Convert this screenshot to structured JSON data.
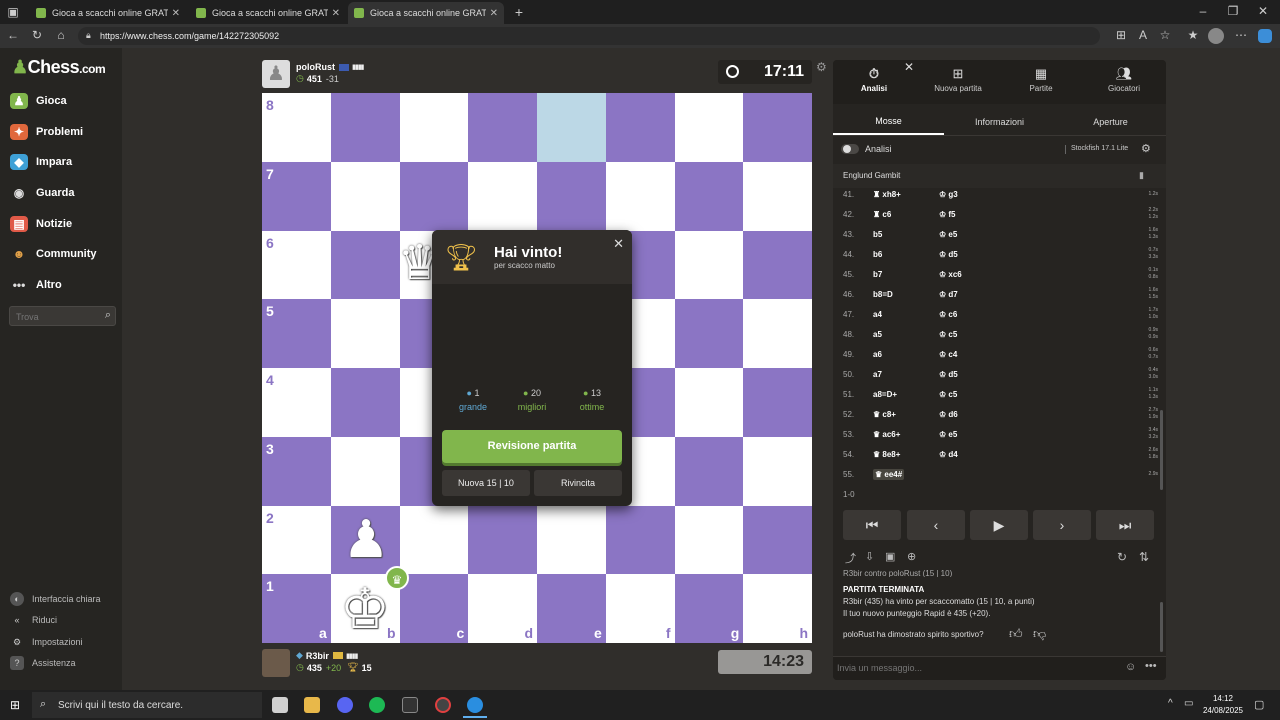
{
  "browser": {
    "tabs": [
      {
        "title": "Gioca a scacchi online GRATIS - S"
      },
      {
        "title": "Gioca a scacchi online GRATIS - S"
      },
      {
        "title": "Gioca a scacchi online GRATIS - S"
      }
    ],
    "url": "https://www.chess.com/game/142272305092"
  },
  "sidebar": {
    "logo": "Chess",
    "logo_suffix": ".com",
    "items": [
      {
        "label": "Gioca",
        "icon": "play-icon",
        "color": "#81b64c"
      },
      {
        "label": "Problemi",
        "icon": "puzzle-icon",
        "color": "#e0683c"
      },
      {
        "label": "Impara",
        "icon": "learn-icon",
        "color": "#3ea0d6"
      },
      {
        "label": "Guarda",
        "icon": "watch-icon",
        "color": "#dddddd"
      },
      {
        "label": "Notizie",
        "icon": "news-icon",
        "color": "#e05a48"
      },
      {
        "label": "Community",
        "icon": "community-icon",
        "color": "#e0a048"
      },
      {
        "label": "Altro",
        "icon": "more-icon",
        "color": "#dddddd"
      }
    ],
    "search_placeholder": "Trova",
    "bottom_items": [
      {
        "label": "Interfaccia chiara"
      },
      {
        "label": "Riduci"
      },
      {
        "label": "Impostazioni"
      },
      {
        "label": "Assistenza"
      }
    ]
  },
  "top_player": {
    "name": "poloRust",
    "rating": "451",
    "rating_change": "-31",
    "clock": "17:11"
  },
  "bottom_player": {
    "name": "R3bir",
    "rating": "435",
    "rating_change": "+20",
    "trophies": "15",
    "clock": "14:23"
  },
  "board": {
    "ranks": [
      "8",
      "7",
      "6",
      "5",
      "4",
      "3",
      "2",
      "1"
    ],
    "files": [
      "a",
      "b",
      "c",
      "d",
      "e",
      "f",
      "g",
      "h"
    ],
    "light_color": "#ffffff",
    "dark_color": "#8b75c4",
    "highlight_color": "#bcd8e6"
  },
  "modal": {
    "title": "Hai vinto!",
    "subtitle": "per scacco matto",
    "stats": [
      {
        "count": "1",
        "label": "grande",
        "color": "#5fa8d3"
      },
      {
        "count": "20",
        "label": "migliori",
        "color": "#81b64c"
      },
      {
        "count": "13",
        "label": "ottime",
        "color": "#81b64c"
      }
    ],
    "review_button": "Revisione partita",
    "new_game_button": "Nuova 15 | 10",
    "rematch_button": "Rivincita"
  },
  "panel": {
    "tabs": [
      {
        "label": "Analisi",
        "icon": "analysis-icon"
      },
      {
        "label": "Nuova partita",
        "icon": "new-game-icon"
      },
      {
        "label": "Partite",
        "icon": "games-icon"
      },
      {
        "label": "Giocatori",
        "icon": "players-icon"
      }
    ],
    "subtabs": [
      "Mosse",
      "Informazioni",
      "Aperture"
    ],
    "analysis_label": "Analisi",
    "engine": "Stockfish 17.1 Lite",
    "opening": "Englund Gambit",
    "moves": [
      {
        "n": "41.",
        "w": "♜ xh8+",
        "b": "♔ g3",
        "t1": "1.2s",
        "t2": ""
      },
      {
        "n": "42.",
        "w": "♜ c6",
        "b": "♔ f5",
        "t1": "2.2s",
        "t2": "1.2s"
      },
      {
        "n": "43.",
        "w": "b5",
        "b": "♔ e5",
        "t1": "1.6s",
        "t2": "1.3s"
      },
      {
        "n": "44.",
        "w": "b6",
        "b": "♔ d5",
        "t1": "0.7s",
        "t2": "3.3s"
      },
      {
        "n": "45.",
        "w": "b7",
        "b": "♔ xc6",
        "t1": "0.1s",
        "t2": "0.8s"
      },
      {
        "n": "46.",
        "w": "b8=D",
        "b": "♔ d7",
        "t1": "1.6s",
        "t2": "1.5s"
      },
      {
        "n": "47.",
        "w": "a4",
        "b": "♔ c6",
        "t1": "1.7s",
        "t2": "1.0s"
      },
      {
        "n": "48.",
        "w": "a5",
        "b": "♔ c5",
        "t1": "0.9s",
        "t2": "0.9s"
      },
      {
        "n": "49.",
        "w": "a6",
        "b": "♔ c4",
        "t1": "0.6s",
        "t2": "0.7s"
      },
      {
        "n": "50.",
        "w": "a7",
        "b": "♔ d5",
        "t1": "0.4s",
        "t2": "3.0s"
      },
      {
        "n": "51.",
        "w": "a8=D+",
        "b": "♔ c5",
        "t1": "1.1s",
        "t2": "1.3s"
      },
      {
        "n": "52.",
        "w": "♛ c8+",
        "b": "♔ d6",
        "t1": "2.7s",
        "t2": "1.9s"
      },
      {
        "n": "53.",
        "w": "♛ ac6+",
        "b": "♔ e5",
        "t1": "3.4s",
        "t2": "3.2s"
      },
      {
        "n": "54.",
        "w": "♛ 8e8+",
        "b": "♔ d4",
        "t1": "2.6s",
        "t2": "1.8s"
      },
      {
        "n": "55.",
        "w": "♛ ee4#",
        "b": "",
        "t1": "2.9s",
        "t2": ""
      }
    ],
    "result": "1-0",
    "chat": {
      "header": "R3bir contro poloRust (15 | 10)",
      "title": "PARTITA TERMINATA",
      "line1": "R3bir (435) ha vinto per scaccomatto (15 | 10, a punti)",
      "line2": "Il tuo nuovo punteggio Rapid è 435 (+20).",
      "sportsmanship": "poloRust ha dimostrato spirito sportivo?",
      "input_placeholder": "Invia un messaggio..."
    }
  },
  "taskbar": {
    "search_placeholder": "Scrivi qui il testo da cercare.",
    "time": "14:12",
    "date": "24/08/2025"
  }
}
